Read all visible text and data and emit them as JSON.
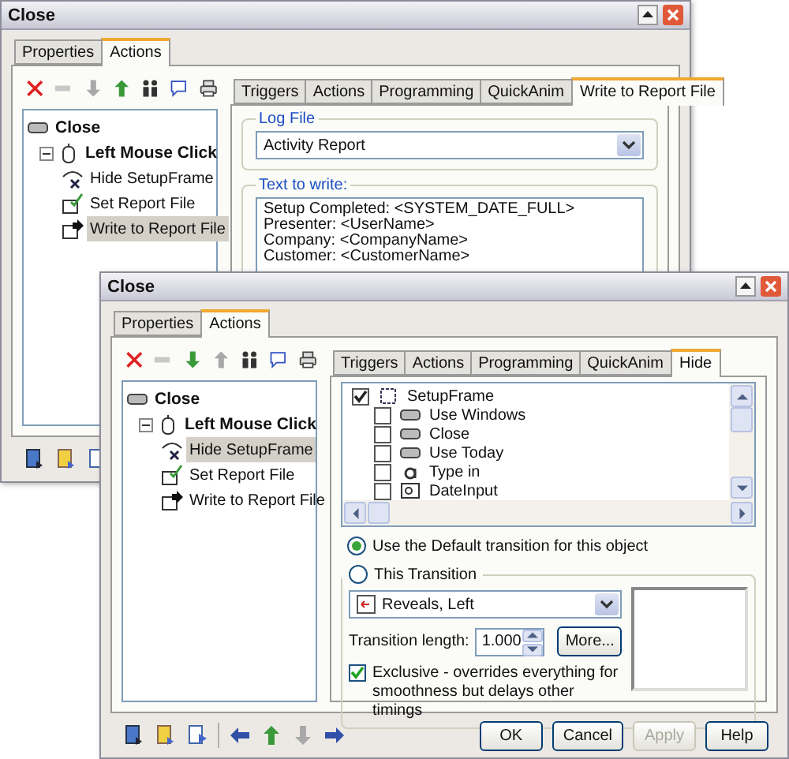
{
  "back_window": {
    "title": "Close",
    "tabs": [
      {
        "label": "Properties",
        "selected": false
      },
      {
        "label": "Actions",
        "selected": true
      }
    ],
    "toolbar": [
      {
        "kind": "delete",
        "disabled": false
      },
      {
        "kind": "move",
        "disabled": true
      },
      {
        "kind": "down",
        "disabled": true
      },
      {
        "kind": "up",
        "disabled": false
      },
      {
        "kind": "people",
        "disabled": false
      },
      {
        "kind": "comment",
        "disabled": false
      },
      {
        "kind": "print",
        "disabled": false
      }
    ],
    "tree": [
      {
        "label": "Close",
        "kind": "object",
        "selected": false,
        "children": [
          {
            "label": "Left Mouse Click",
            "kind": "trigger",
            "selected": false,
            "expanded": true,
            "children": [
              {
                "label": "Hide SetupFrame",
                "kind": "hide",
                "selected": false
              },
              {
                "label": "Set Report File",
                "kind": "set",
                "selected": false
              },
              {
                "label": "Write to Report File",
                "kind": "write",
                "selected": true
              }
            ]
          }
        ]
      }
    ],
    "action_tabs": [
      {
        "label": "Triggers",
        "selected": false
      },
      {
        "label": "Actions",
        "selected": false
      },
      {
        "label": "Programming",
        "selected": false
      },
      {
        "label": "QuickAnim",
        "selected": false
      },
      {
        "label": "Write to Report File",
        "selected": true
      }
    ],
    "log_file": {
      "legend": "Log File",
      "value": "Activity Report"
    },
    "text_to_write": {
      "legend": "Text to write:",
      "lines": [
        "Setup Completed: <SYSTEM_DATE_FULL>",
        "Presenter: <UserName>",
        "Company: <CompanyName>",
        "Customer: <CustomerName>"
      ]
    },
    "bottom_toolbar": [
      {
        "kind": "doc-blue",
        "disabled": false
      },
      {
        "kind": "doc-yellow",
        "disabled": false
      },
      {
        "kind": "doc-arrow",
        "disabled": false
      }
    ]
  },
  "front_window": {
    "title": "Close",
    "tabs": [
      {
        "label": "Properties",
        "selected": false
      },
      {
        "label": "Actions",
        "selected": true
      }
    ],
    "toolbar": [
      {
        "kind": "delete",
        "disabled": false
      },
      {
        "kind": "move",
        "disabled": true
      },
      {
        "kind": "down",
        "disabled": false
      },
      {
        "kind": "up",
        "disabled": true
      },
      {
        "kind": "people",
        "disabled": false
      },
      {
        "kind": "comment",
        "disabled": false
      },
      {
        "kind": "print",
        "disabled": false
      }
    ],
    "tree": [
      {
        "label": "Close",
        "kind": "object",
        "selected": false,
        "children": [
          {
            "label": "Left Mouse Click",
            "kind": "trigger",
            "selected": false,
            "expanded": true,
            "children": [
              {
                "label": "Hide SetupFrame",
                "kind": "hide",
                "selected": true
              },
              {
                "label": "Set Report File",
                "kind": "set",
                "selected": false
              },
              {
                "label": "Write to Report File",
                "kind": "write",
                "selected": false
              }
            ]
          }
        ]
      }
    ],
    "action_tabs": [
      {
        "label": "Triggers",
        "selected": false
      },
      {
        "label": "Actions",
        "selected": false
      },
      {
        "label": "Programming",
        "selected": false
      },
      {
        "label": "QuickAnim",
        "selected": false
      },
      {
        "label": "Hide",
        "selected": true
      }
    ],
    "objects": [
      {
        "label": "SetupFrame",
        "kind": "frame",
        "checked": true,
        "children": [
          {
            "label": "Use Windows",
            "kind": "button",
            "checked": false
          },
          {
            "label": "Close",
            "kind": "button",
            "checked": false
          },
          {
            "label": "Use Today",
            "kind": "button",
            "checked": false
          },
          {
            "label": "Type in",
            "kind": "text",
            "checked": false
          },
          {
            "label": "DateInput",
            "kind": "input",
            "checked": false
          }
        ]
      }
    ],
    "default_transition": {
      "label": "Use the Default transition for this object",
      "selected": true
    },
    "this_transition": {
      "label": "This Transition",
      "selected": false
    },
    "transition": {
      "value": "Reveals, Left"
    },
    "length": {
      "label": "Transition length:",
      "value": "1.000"
    },
    "more_button": "More...",
    "exclusive": {
      "label": "Exclusive - overrides everything for smoothness but delays other timings",
      "checked": true
    },
    "bottom_toolbar": [
      {
        "kind": "doc-blue",
        "disabled": false
      },
      {
        "kind": "doc-yellow",
        "disabled": false
      },
      {
        "kind": "doc-arrow",
        "disabled": false
      },
      {
        "kind": "left",
        "disabled": false
      },
      {
        "kind": "up",
        "disabled": false
      },
      {
        "kind": "down",
        "disabled": true
      },
      {
        "kind": "right",
        "disabled": false
      }
    ],
    "buttons": [
      {
        "label": "OK",
        "disabled": false
      },
      {
        "label": "Cancel",
        "disabled": false
      },
      {
        "label": "Apply",
        "disabled": true
      },
      {
        "label": "Help",
        "disabled": false
      }
    ]
  }
}
